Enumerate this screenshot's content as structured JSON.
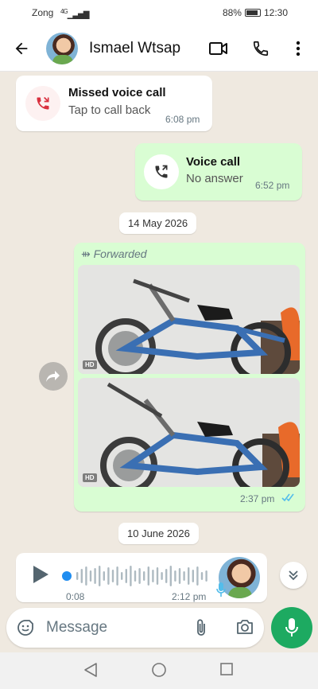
{
  "status_bar": {
    "carrier": "Zong",
    "network": "4G",
    "battery": "88%",
    "time": "12:30"
  },
  "header": {
    "contact_name": "Ismael Wtsap",
    "icons": [
      "back-arrow-icon",
      "video-call-icon",
      "phone-icon",
      "more-vert-icon"
    ]
  },
  "messages": {
    "missed_call": {
      "title": "Missed voice call",
      "subtitle": "Tap to call back",
      "time": "6:08 pm"
    },
    "voice_call": {
      "title": "Voice call",
      "subtitle": "No answer",
      "time": "6:52 pm"
    },
    "date_1": "14 May 2026",
    "forwarded": {
      "label": "Forwarded",
      "time": "2:37 pm",
      "photos": [
        {
          "badge": "HD"
        },
        {
          "badge": "HD"
        }
      ],
      "status": "read"
    },
    "date_2": "10 June 2026",
    "voice_note": {
      "duration": "0:08",
      "time": "2:12 pm",
      "progress": 0
    }
  },
  "composer": {
    "placeholder": "Message"
  },
  "colors": {
    "accent_green": "#1daa61",
    "bubble_out": "#d9fdd3",
    "bubble_in": "#ffffff",
    "missed_red": "#d9303e",
    "read_ticks": "#53bdeb",
    "chat_bg": "#efe9e0"
  }
}
